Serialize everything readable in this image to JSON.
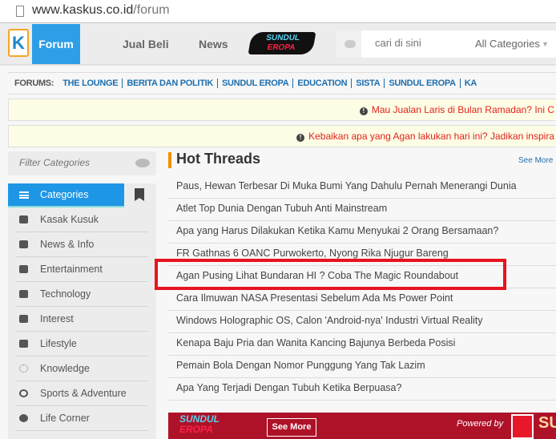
{
  "browser": {
    "url_domain": "www.kaskus.co.id",
    "url_path": "/forum"
  },
  "nav": {
    "logo": "K",
    "tabs": [
      "Forum",
      "Jual Beli",
      "News"
    ],
    "promo_logo": "SUNDUL EROPA",
    "search_placeholder": "cari di sini",
    "category_select": "All Categories"
  },
  "forums": {
    "label": "FORUMS:",
    "links": [
      "THE LOUNGE",
      "BERITA DAN POLITIK",
      "SUNDUL EROPA",
      "EDUCATION",
      "SISTA",
      "SUNDUL EROPA",
      "KA"
    ]
  },
  "notices": [
    "Mau Jualan Laris di Bulan Ramadan? Ini C",
    "Kebaikan apa yang Agan lakukan hari ini? Jadikan inspira"
  ],
  "sidebar": {
    "filter_placeholder": "Filter Categories",
    "tab": "Categories",
    "items": [
      {
        "label": "Kasak Kusuk",
        "icon": "chat-bubbles-icon"
      },
      {
        "label": "News & Info",
        "icon": "briefcase-icon"
      },
      {
        "label": "Entertainment",
        "icon": "tv-icon"
      },
      {
        "label": "Technology",
        "icon": "rocket-icon"
      },
      {
        "label": "Interest",
        "icon": "palette-icon"
      },
      {
        "label": "Lifestyle",
        "icon": "top-hat-icon"
      },
      {
        "label": "Knowledge",
        "icon": "lightbulb-icon"
      },
      {
        "label": "Sports & Adventure",
        "icon": "stopwatch-icon"
      },
      {
        "label": "Life Corner",
        "icon": "apple-icon"
      }
    ]
  },
  "hot": {
    "title": "Hot Threads",
    "see_more": "See More",
    "threads": [
      "Paus, Hewan Terbesar Di Muka Bumi Yang Dahulu Pernah Menerangi Dunia",
      "Atlet Top Dunia Dengan Tubuh Anti Mainstream",
      "Apa yang Harus Dilakukan Ketika Kamu Menyukai 2 Orang Bersamaan?",
      "FR Gathnas 6 OANC Purwokerto, Nyong Rika Njugur Bareng",
      "Agan Pusing Lihat Bundaran HI ? Coba The Magic Roundabout",
      "Cara Ilmuwan NASA Presentasi Sebelum Ada Ms Power Point",
      "Windows Holographic OS, Calon 'Android-nya' Industri Virtual Reality",
      "Kenapa Baju Pria dan Wanita Kancing Bajunya Berbeda Posisi",
      "Pemain Bola Dengan Nomor Punggung Yang Tak Lazim",
      "Apa Yang Terjadi Dengan Tubuh Ketika Berpuasa?"
    ]
  },
  "banner": {
    "logo_top": "SUNDUL",
    "logo_bottom": "EROPA",
    "see_more": "See More",
    "powered_by": "Powered by",
    "sponsor": "SU"
  },
  "colors": {
    "accent": "#2e9ee8",
    "highlight": "#e8131f",
    "banner": "#ae1228"
  }
}
